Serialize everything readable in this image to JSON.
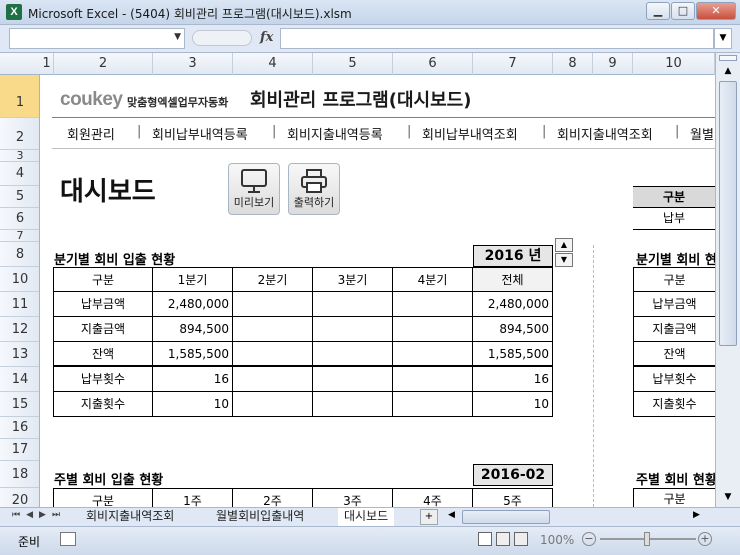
{
  "window": {
    "title": "Microsoft Excel - (5404) 회비관리 프로그램(대시보드).xlsm",
    "app_icon": "X"
  },
  "formula_bar": {
    "fx": "fx",
    "name_box": "",
    "formula": ""
  },
  "columns": [
    "1",
    "2",
    "3",
    "4",
    "5",
    "6",
    "7",
    "8",
    "9",
    "10"
  ],
  "rows": [
    "1",
    "2",
    "3",
    "4",
    "5",
    "6",
    "7",
    "8",
    "10",
    "11",
    "12",
    "13",
    "14",
    "15",
    "16",
    "17",
    "18",
    "20"
  ],
  "brand": {
    "logo": "coukey",
    "tagline": "맞춤형엑셀업무자동화",
    "program_title": "회비관리 프로그램(대시보드)"
  },
  "nav": {
    "items": [
      "회원관리",
      "회비납부내역등록",
      "회비지출내역등록",
      "회비납부내역조회",
      "회비지출내역조회",
      "월별"
    ]
  },
  "dashboard": {
    "title": "대시보드",
    "preview_button": "미리보기",
    "print_button": "출력하기"
  },
  "quarterly": {
    "heading": "분기별 회비 입출 현황",
    "year": "2016 년",
    "headers": [
      "구분",
      "1분기",
      "2분기",
      "3분기",
      "4분기",
      "전체"
    ],
    "rows": [
      [
        "납부금액",
        "2,480,000",
        "",
        "",
        "",
        "2,480,000"
      ],
      [
        "지출금액",
        "894,500",
        "",
        "",
        "",
        "894,500"
      ],
      [
        "잔액",
        "1,585,500",
        "",
        "",
        "",
        "1,585,500"
      ],
      [
        "납부횟수",
        "16",
        "",
        "",
        "",
        "16"
      ],
      [
        "지출횟수",
        "10",
        "",
        "",
        "",
        "10"
      ]
    ]
  },
  "weekly": {
    "heading": "주별 회비 입출 현황",
    "month": "2016-02",
    "headers": [
      "구분",
      "1주",
      "2주",
      "3주",
      "4주",
      "5주"
    ]
  },
  "right_panel": {
    "summary_header": "구분",
    "summary_row": "납부",
    "quarter_heading": "분기별 회비 현",
    "header": "구분",
    "rows": [
      "납부금액",
      "지출금액",
      "잔액",
      "납부횟수",
      "지출횟수"
    ],
    "weekly_heading": "주별 회비 현황",
    "weekly_header": "구분"
  },
  "sheet_tabs": [
    "회비지출내역조회",
    "월별회비입출내역",
    "대시보드"
  ],
  "status": {
    "ready": "준비",
    "zoom": "100%"
  }
}
